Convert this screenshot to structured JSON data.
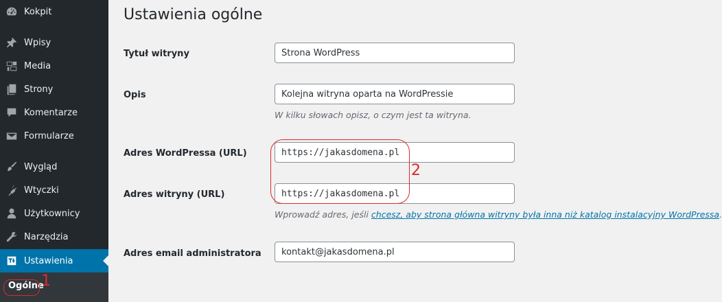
{
  "sidebar": {
    "items": [
      {
        "label": "Kokpit",
        "icon": "dashboard-icon"
      },
      {
        "label": "Wpisy",
        "icon": "pin-icon"
      },
      {
        "label": "Media",
        "icon": "media-icon"
      },
      {
        "label": "Strony",
        "icon": "pages-icon"
      },
      {
        "label": "Komentarze",
        "icon": "comment-icon"
      },
      {
        "label": "Formularze",
        "icon": "mail-icon"
      },
      {
        "label": "Wygląd",
        "icon": "paintbrush-icon"
      },
      {
        "label": "Wtyczki",
        "icon": "plugin-icon"
      },
      {
        "label": "Użytkownicy",
        "icon": "user-icon"
      },
      {
        "label": "Narzędzia",
        "icon": "wrench-icon"
      },
      {
        "label": "Ustawienia",
        "icon": "settings-icon",
        "active": true
      }
    ],
    "submenu": {
      "label": "Ogólne"
    }
  },
  "main": {
    "title": "Ustawienia ogólne",
    "fields": {
      "site_title": {
        "label": "Tytuł witryny",
        "value": "Strona WordPress"
      },
      "tagline": {
        "label": "Opis",
        "value": "Kolejna witryna oparta na WordPressie",
        "description": "W kilku słowach opisz, o czym jest ta witryna."
      },
      "wp_address": {
        "label": "Adres WordPressa (URL)",
        "value": "https://jakasdomena.pl"
      },
      "site_address": {
        "label": "Adres witryny (URL)",
        "value": "https://jakasdomena.pl",
        "description_prefix": "Wprowadź adres, jeśli ",
        "description_link": "chcesz, aby strona główna witryny była inna niż katalog instalacyjny WordPressa",
        "description_suffix": "."
      },
      "admin_email": {
        "label": "Adres email administratora",
        "value": "kontakt@jakasdomena.pl"
      }
    }
  },
  "annotations": {
    "marker_1": "1",
    "marker_2": "2",
    "color": "#d92b2b"
  },
  "colors": {
    "sidebar_bg": "#23282d",
    "active_bg": "#0073aa",
    "link": "#0073aa"
  }
}
